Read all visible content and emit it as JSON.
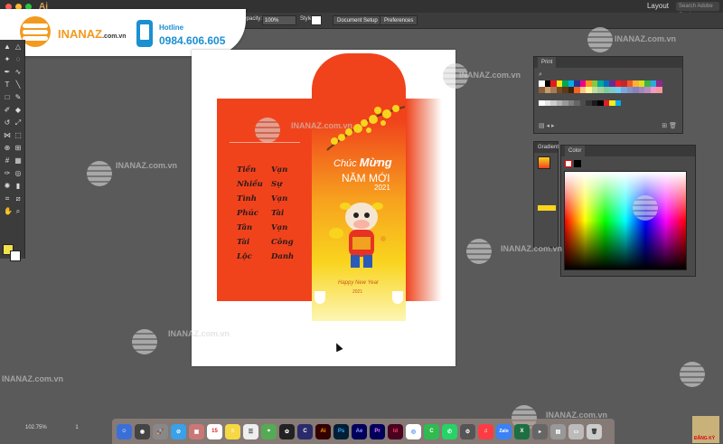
{
  "app": {
    "name": "Ai",
    "layout_label": "Layout",
    "search_placeholder": "Search Adobe Stock"
  },
  "control_bar": {
    "opacity_label": "Opacity:",
    "opacity_value": "100%",
    "style_label": "Style:",
    "document_setup": "Document Setup",
    "preferences": "Preferences"
  },
  "brand": {
    "name": "INANAZ",
    "domain": ".com.vn",
    "hotline_label": "Hotline",
    "hotline_number": "0984.606.605"
  },
  "envelope": {
    "greeting_line1_a": "Chúc",
    "greeting_line1_b": "Mừng",
    "greeting_line2": "NĂM MỚI",
    "greeting_year": "2021",
    "footer_line1": "Happy New Year",
    "footer_line2": "2021",
    "poem_col1": [
      "Tiền",
      "Nhiều",
      "Tình",
      "Phúc",
      "Tân",
      "Tài",
      "Lộc"
    ],
    "poem_col2": [
      "Vạn",
      "Sự",
      "Vạn",
      "Tài",
      "Vạn",
      "Công",
      "Danh"
    ]
  },
  "panels": {
    "print": "Print",
    "gradient": "Gradient",
    "color": "Color"
  },
  "watermark": "INANAZ.com.vn",
  "status": {
    "zoom": "102.75%",
    "page": "1"
  },
  "dock": {
    "calendar_day": "15",
    "apps": [
      "Ai",
      "Ps",
      "Ae",
      "Pr",
      "Id",
      "Zalo",
      "X"
    ]
  },
  "corner": "ĐĂNG KÝ",
  "colors": {
    "brand_orange": "#f39a1e",
    "brand_blue": "#1a8fd1",
    "envelope_red": "#f0431c",
    "envelope_yellow": "#f9d41e"
  }
}
